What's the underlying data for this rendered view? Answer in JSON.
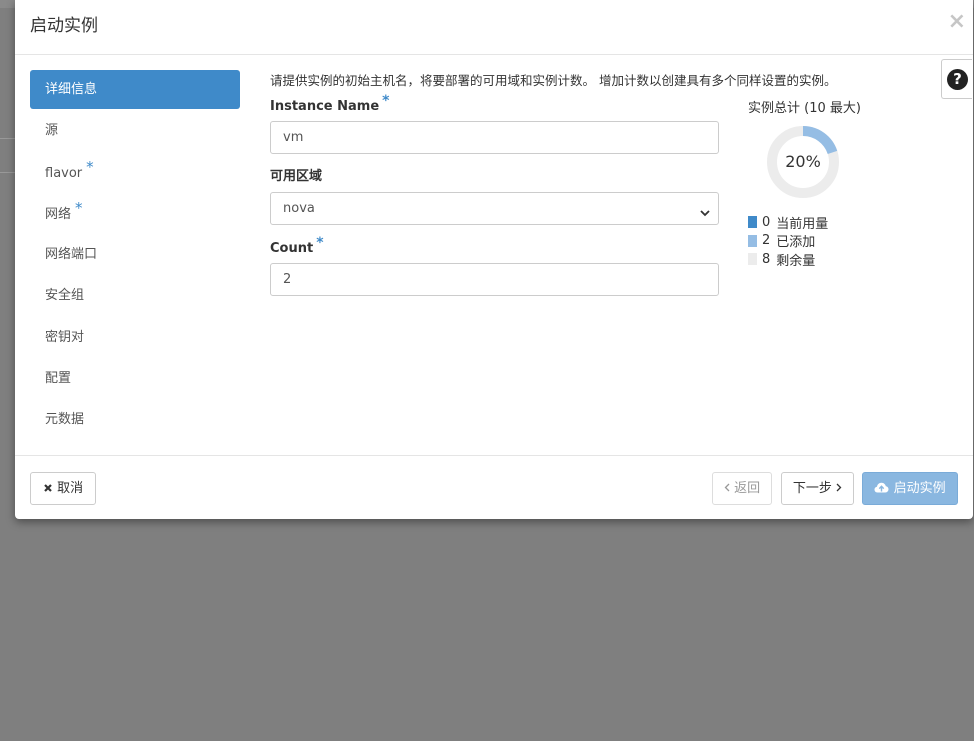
{
  "modal": {
    "title": "启动实例",
    "close_icon": "×",
    "help_icon": "?"
  },
  "sidebar": {
    "items": [
      {
        "label": "详细信息",
        "required": false,
        "active": true
      },
      {
        "label": "源",
        "required": false
      },
      {
        "label": "flavor",
        "required": true
      },
      {
        "label": "网络",
        "required": true
      },
      {
        "label": "网络端口",
        "required": false
      },
      {
        "label": "安全组",
        "required": false
      },
      {
        "label": "密钥对",
        "required": false
      },
      {
        "label": "配置",
        "required": false
      },
      {
        "label": "元数据",
        "required": false
      }
    ],
    "required_marker": "*"
  },
  "details": {
    "intro": "请提供实例的初始主机名，将要部署的可用域和实例计数。 增加计数以创建具有多个同样设置的实例。",
    "instance_name": {
      "label": "Instance Name",
      "value": "vm"
    },
    "availability_zone": {
      "label": "可用区域",
      "value": "nova"
    },
    "count": {
      "label": "Count",
      "value": "2"
    }
  },
  "quota": {
    "title": "实例总计 (10 最大)",
    "percent_label": "20%",
    "percent": 0.2,
    "legend": [
      {
        "value": "0",
        "label": "当前用量",
        "color": "#3f8ac9"
      },
      {
        "value": "2",
        "label": "已添加",
        "color": "#95bde4"
      },
      {
        "value": "8",
        "label": "剩余量",
        "color": "#ececec"
      }
    ]
  },
  "footer": {
    "cancel_label": "取消",
    "back_label": "返回",
    "next_label": "下一步",
    "launch_label": "启动实例"
  },
  "colors": {
    "accent": "#3f8ac9",
    "added": "#95bde4",
    "remaining": "#ececec",
    "backdrop": "#7f7f7f"
  }
}
